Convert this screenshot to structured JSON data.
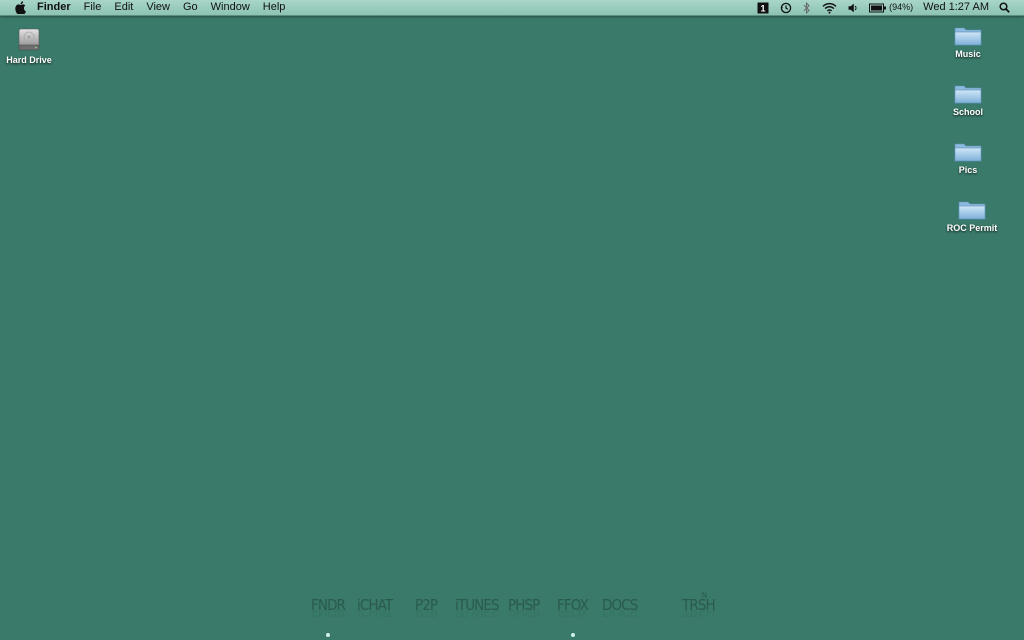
{
  "menubar": {
    "app_name": "Finder",
    "menus": [
      "File",
      "Edit",
      "View",
      "Go",
      "Window",
      "Help"
    ],
    "status": {
      "battery_percent": "(94%)",
      "clock": "Wed 1:27 AM",
      "icons": [
        "spaces-icon",
        "time-machine-icon",
        "bluetooth-icon",
        "wifi-icon",
        "volume-icon",
        "battery-icon",
        "spotlight-icon"
      ]
    }
  },
  "desktop": {
    "background_color": "#3a7a6a",
    "left_icons": [
      {
        "label": "Hard Drive",
        "icon": "hard-drive-icon"
      }
    ],
    "right_icons": [
      {
        "label": "Music",
        "icon": "folder-icon"
      },
      {
        "label": "School",
        "icon": "folder-icon"
      },
      {
        "label": "Pics",
        "icon": "folder-icon"
      },
      {
        "label": "ROC Permit",
        "icon": "folder-icon"
      }
    ]
  },
  "dock": {
    "items": [
      {
        "label": "FNDR",
        "running": true
      },
      {
        "label": "iCHAT",
        "running": false
      },
      {
        "label": "P2P",
        "running": false
      },
      {
        "label": "iTUNES",
        "running": false
      },
      {
        "label": "PHSP",
        "running": false
      },
      {
        "label": "FFOX",
        "running": true
      },
      {
        "label": "DOCS",
        "running": false
      },
      {
        "label": "TRSH",
        "running": false
      }
    ],
    "trash_badge": "N"
  }
}
